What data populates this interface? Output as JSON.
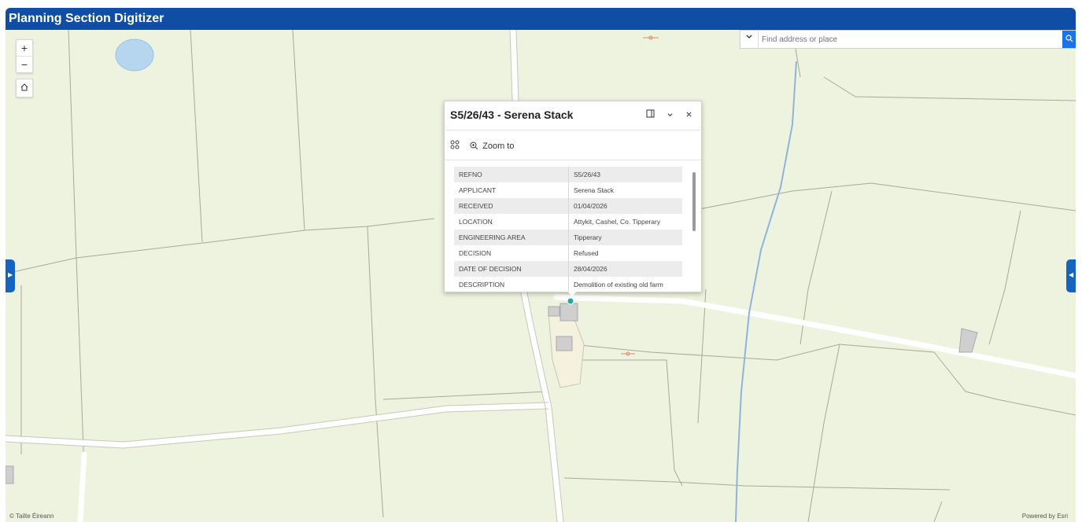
{
  "app": {
    "title": "Planning Section Digitizer"
  },
  "colors": {
    "titlebar": "#0f4ea3",
    "map_background": "#eef3df",
    "accent": "#1565c0",
    "marker": "#23a6a6"
  },
  "map": {
    "zoom_controls": {
      "zoom_in_label": "+",
      "zoom_out_label": "−"
    },
    "home_icon": "home-icon",
    "search": {
      "placeholder": "Find address or place",
      "dropdown_icon": "chevron-down-icon",
      "search_icon": "search-icon"
    },
    "attribution_left": "© Tailte Éireann",
    "attribution_right": "Powered by Esri"
  },
  "popup": {
    "title": "S5/26/43 - Serena Stack",
    "buttons": {
      "dock_icon": "dock-icon",
      "collapse_icon": "chevron-down-icon",
      "close_icon": "close-icon"
    },
    "actions": {
      "more_icon": "grid-icon",
      "zoom_icon": "zoom-in-icon",
      "zoom_label": "Zoom to"
    },
    "fields": [
      {
        "key": "REFNO",
        "value": "S5/26/43"
      },
      {
        "key": "APPLICANT",
        "value": "Serena Stack"
      },
      {
        "key": "RECEIVED",
        "value": "01/04/2026"
      },
      {
        "key": "LOCATION",
        "value": "Attykit, Cashel, Co. Tipperary"
      },
      {
        "key": "ENGINEERING AREA",
        "value": "Tipperary"
      },
      {
        "key": "DECISION",
        "value": "Refused"
      },
      {
        "key": "DATE OF DECISION",
        "value": "28/04/2026"
      },
      {
        "key": "DESCRIPTION",
        "value": "Demolition of existing old farm"
      }
    ]
  }
}
